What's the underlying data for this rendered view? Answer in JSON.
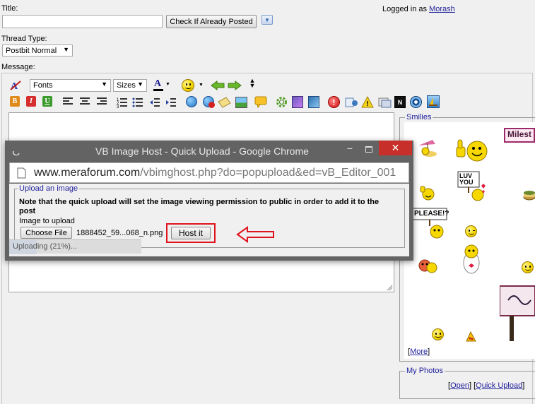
{
  "form": {
    "title_label": "Title:",
    "title_value": "",
    "check_button": "Check If Already Posted",
    "logged_prefix": "Logged in as",
    "username": "Morash",
    "thread_type_label": "Thread Type:",
    "thread_type_value": "Postbit Normal",
    "message_label": "Message:"
  },
  "toolbar": {
    "font_value": "Fonts",
    "size_value": "Sizes",
    "text_color_letter": "A",
    "bold": "B",
    "italic": "I",
    "underline": "U"
  },
  "smilies": {
    "legend": "Smilies",
    "more_link": "More",
    "luv_text": "LUV YOU",
    "please_text": "PLEASE!?",
    "milestone_text": "Milest"
  },
  "photos": {
    "legend": "My Photos",
    "open_link": "Open",
    "quick_upload_link": "Quick Upload"
  },
  "popup": {
    "window_title": "VB Image Host - Quick Upload - Google Chrome",
    "url_host": "www.meraforum.com",
    "url_path": "/vbimghost.php?do=popupload&ed=vB_Editor_001",
    "legend": "Upload an image",
    "note": "Note that the quick upload will set the image viewing permission to public in order to add it to the post",
    "image_label": "Image to upload",
    "choose_file": "Choose File",
    "file_name": "1888452_59...068_n.png",
    "host_button": "Host it",
    "status": "Uploading (21%)...",
    "progress": 0.21
  },
  "colors": {
    "link": "#22229c",
    "annotation_red": "#e0141e",
    "chrome_frame": "#636363",
    "close_button": "#c7302a"
  }
}
